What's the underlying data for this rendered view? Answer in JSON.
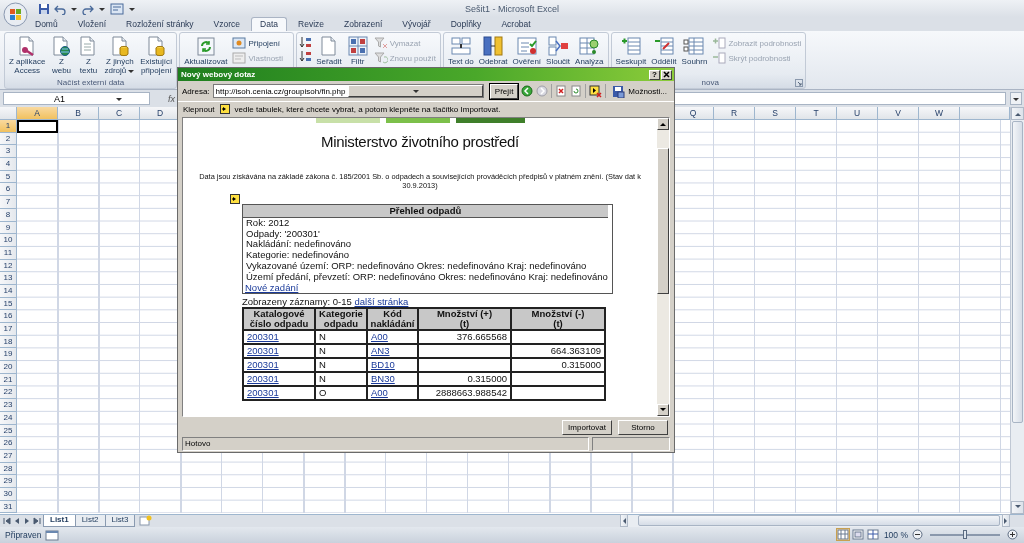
{
  "window": {
    "title": "Sešit1 - Microsoft Excel"
  },
  "ribbon_tabs": [
    {
      "label": "Domů",
      "selected": false
    },
    {
      "label": "Vložení",
      "selected": false
    },
    {
      "label": "Rozložení stránky",
      "selected": false
    },
    {
      "label": "Vzorce",
      "selected": false
    },
    {
      "label": "Data",
      "selected": true
    },
    {
      "label": "Revize",
      "selected": false
    },
    {
      "label": "Zobrazení",
      "selected": false
    },
    {
      "label": "Vývojář",
      "selected": false
    },
    {
      "label": "Doplňky",
      "selected": false
    },
    {
      "label": "Acrobat",
      "selected": false
    }
  ],
  "ribbon_groups": [
    {
      "label": "Načíst externí data",
      "items": [
        {
          "kind": "large",
          "lines": [
            "Z aplikace",
            "Access"
          ],
          "menu": false
        },
        {
          "kind": "large",
          "lines": [
            "Z",
            "webu"
          ],
          "menu": false
        },
        {
          "kind": "large",
          "lines": [
            "Z",
            "textu"
          ],
          "menu": false
        },
        {
          "kind": "large",
          "lines": [
            "Z jiných",
            "zdrojů"
          ],
          "menu": true
        },
        {
          "kind": "large",
          "lines": [
            "Existující",
            "připojení"
          ],
          "menu": false
        }
      ]
    },
    {
      "items": [
        {
          "kind": "large",
          "lines": [
            "Aktualizovat"
          ],
          "menu": false
        },
        {
          "kind": "small_stack",
          "items": [
            {
              "label": "Připojení",
              "disabled": false
            },
            {
              "label": "Vlastnosti",
              "disabled": true
            }
          ]
        }
      ]
    },
    {
      "items": [
        {
          "kind": "sort_icons"
        },
        {
          "kind": "large",
          "lines": [
            "Seřadit"
          ],
          "menu": false
        },
        {
          "kind": "large",
          "lines": [
            "Filtr"
          ],
          "menu": false
        },
        {
          "kind": "small_stack",
          "items": [
            {
              "label": "Vymazat",
              "disabled": true
            },
            {
              "label": "Znovu použít",
              "disabled": true
            }
          ]
        }
      ]
    },
    {
      "items": [
        {
          "kind": "large",
          "lines": [
            "Text do"
          ],
          "menu": false
        },
        {
          "kind": "large",
          "lines": [
            "Odebrat"
          ],
          "menu": false
        },
        {
          "kind": "large",
          "lines": [
            "Ověření"
          ],
          "menu": false
        },
        {
          "kind": "large",
          "lines": [
            "Sloučit"
          ],
          "menu": false
        },
        {
          "kind": "large",
          "lines": [
            "Analýza"
          ],
          "menu": false
        }
      ]
    },
    {
      "label": "nova",
      "items": [
        {
          "kind": "large",
          "lines": [
            "Seskupit"
          ],
          "menu": false
        },
        {
          "kind": "large",
          "lines": [
            "Oddělit"
          ],
          "menu": false
        },
        {
          "kind": "large",
          "lines": [
            "Souhrn"
          ],
          "menu": false
        },
        {
          "kind": "small_stack",
          "items": [
            {
              "label": "Zobrazit podrobnosti",
              "disabled": true
            },
            {
              "label": "Skrýt podrobnosti",
              "disabled": true
            }
          ]
        }
      ]
    }
  ],
  "formula_bar": {
    "name_box": "A1",
    "function_label": "fx"
  },
  "sheet": {
    "columns": [
      {
        "label": "A",
        "selected": true
      },
      {
        "label": "B",
        "selected": false
      },
      {
        "label": "C",
        "selected": false
      },
      {
        "label": "D",
        "selected": false
      }
    ],
    "right_columns": [
      {
        "label": "Q",
        "selected": false
      },
      {
        "label": "R",
        "selected": false
      },
      {
        "label": "S",
        "selected": false
      },
      {
        "label": "T",
        "selected": false
      },
      {
        "label": "U",
        "selected": false
      },
      {
        "label": "V",
        "selected": false
      },
      {
        "label": "W",
        "selected": false
      }
    ],
    "rows": [
      {
        "label": "1",
        "selected": true
      },
      {
        "label": "2",
        "selected": false
      },
      {
        "label": "3",
        "selected": false
      },
      {
        "label": "4",
        "selected": false
      },
      {
        "label": "5",
        "selected": false
      },
      {
        "label": "6",
        "selected": false
      },
      {
        "label": "7",
        "selected": false
      },
      {
        "label": "8",
        "selected": false
      },
      {
        "label": "9",
        "selected": false
      },
      {
        "label": "10",
        "selected": false
      },
      {
        "label": "11",
        "selected": false
      },
      {
        "label": "12",
        "selected": false
      },
      {
        "label": "13",
        "selected": false
      },
      {
        "label": "14",
        "selected": false
      },
      {
        "label": "15",
        "selected": false
      },
      {
        "label": "16",
        "selected": false
      },
      {
        "label": "17",
        "selected": false
      },
      {
        "label": "18",
        "selected": false
      },
      {
        "label": "19",
        "selected": false
      },
      {
        "label": "20",
        "selected": false
      },
      {
        "label": "21",
        "selected": false
      },
      {
        "label": "22",
        "selected": false
      },
      {
        "label": "23",
        "selected": false
      },
      {
        "label": "24",
        "selected": false
      },
      {
        "label": "25",
        "selected": false
      },
      {
        "label": "26",
        "selected": false
      },
      {
        "label": "27",
        "selected": false
      },
      {
        "label": "28",
        "selected": false
      },
      {
        "label": "29",
        "selected": false
      },
      {
        "label": "30",
        "selected": false
      },
      {
        "label": "31",
        "selected": false
      }
    ]
  },
  "sheet_tabs": [
    {
      "label": "List1",
      "selected": true
    },
    {
      "label": "List2",
      "selected": false
    },
    {
      "label": "List3",
      "selected": false
    }
  ],
  "status_bar": {
    "text": "Připraven",
    "zoom": {
      "label": "100 %",
      "level": 0.5
    }
  },
  "dialog": {
    "title": "Nový webový dotaz",
    "help_button": "?",
    "address_label": "Adresa:",
    "address": "http://isoh.cenia.cz/groupisoh/fin.php",
    "go_button": "Přejít",
    "options_button": "Možnosti...",
    "hint_before": "Klepnout",
    "hint_after": "vedle tabulek, které chcete vybrat, a potom klepněte na tlačítko Importovat.",
    "page": {
      "heading": "Ministerstvo životního prostředí",
      "intro": "Data jsou získávána na základě zákona č. 185/2001 Sb. o odpadech a souvisejících prováděcích předpisů v platném znění. (Stav dat k 30.9.2013)",
      "summary": {
        "title": "Přehled odpadů",
        "lines": [
          "Rok: 2012",
          "Odpady: '200301'",
          "Nakládání: nedefinováno",
          "Kategorie: nedefinováno",
          "Vykazované území:  ORP: nedefinováno Okres: nedefinováno Kraj: nedefinováno",
          "Území předání, převzetí:  ORP: nedefinováno Okres: nedefinováno Kraj: nedefinováno"
        ],
        "link": "Nové zadání"
      },
      "records_label": "Zobrazeny záznamy: 0-15",
      "next_link": "další stránka",
      "table": {
        "columns": [
          {
            "lines": [
              "Katalogové",
              "číslo odpadu"
            ]
          },
          {
            "lines": [
              "Kategorie",
              "odpadu"
            ]
          },
          {
            "lines": [
              "Kód",
              "nakládání"
            ]
          },
          {
            "lines": [
              "Množství (+)",
              "(t)"
            ]
          },
          {
            "lines": [
              "Množství (-)",
              "(t)"
            ]
          }
        ],
        "rows": [
          {
            "code": "200301",
            "category": "N",
            "treatment": "A00",
            "plus": "376.665568"
          },
          {
            "code": "200301",
            "category": "N",
            "treatment": "AN3",
            "minus": "664.363109"
          },
          {
            "code": "200301",
            "category": "N",
            "treatment": "BD10",
            "minus": "0.315000"
          },
          {
            "code": "200301",
            "category": "N",
            "treatment": "BN30",
            "plus": "0.315000"
          },
          {
            "code": "200301",
            "category": "O",
            "treatment": "A00",
            "plus": "2888663.988542"
          }
        ]
      }
    },
    "buttons": [
      "Importovat",
      "Storno"
    ],
    "status": "Hotovo"
  }
}
